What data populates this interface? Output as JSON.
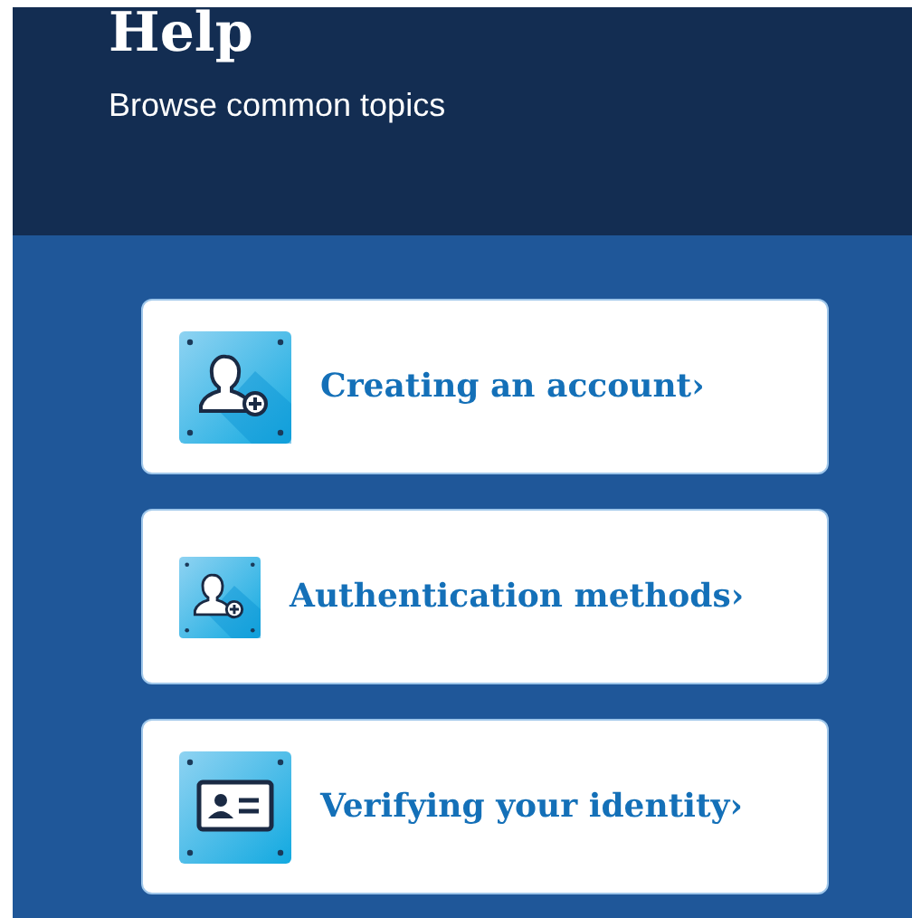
{
  "header": {
    "title": "Help",
    "subtitle": "Browse common topics"
  },
  "topics": [
    {
      "label": "Creating an account›",
      "kind": "user-add",
      "compact": false
    },
    {
      "label": "Authentication methods›",
      "kind": "user-add",
      "compact": true
    },
    {
      "label": "Verifying your identity›",
      "kind": "id-card",
      "compact": false
    }
  ]
}
